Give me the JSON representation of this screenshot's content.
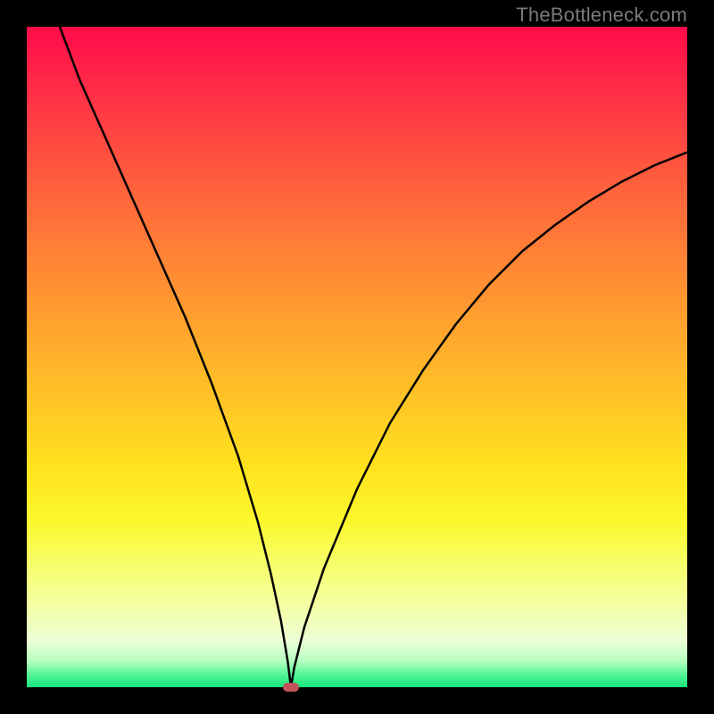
{
  "watermark": "TheBottleneck.com",
  "colors": {
    "frame": "#000000",
    "curve": "#000000",
    "marker": "#c25358"
  },
  "chart_data": {
    "type": "line",
    "title": "",
    "xlabel": "",
    "ylabel": "",
    "xlim": [
      0,
      100
    ],
    "ylim": [
      0,
      100
    ],
    "grid": false,
    "legend": false,
    "series": [
      {
        "name": "curve",
        "x": [
          5,
          8,
          12,
          16,
          20,
          24,
          28,
          32,
          35,
          37,
          38.5,
          39.5,
          40,
          40.5,
          42,
          45,
          50,
          55,
          60,
          65,
          70,
          75,
          80,
          85,
          90,
          95,
          100
        ],
        "y": [
          100,
          92,
          83,
          74,
          65,
          56,
          46,
          35,
          25,
          17,
          10,
          4,
          0,
          3,
          9,
          18,
          30,
          40,
          48,
          55,
          61,
          66,
          70,
          73.5,
          76.5,
          79,
          81
        ]
      }
    ],
    "marker": {
      "x": 40,
      "y": 0
    },
    "background_gradient": [
      {
        "stop": 0,
        "color": "#ff0b4a"
      },
      {
        "stop": 50,
        "color": "#ffb62a"
      },
      {
        "stop": 75,
        "color": "#fbf82e"
      },
      {
        "stop": 100,
        "color": "#18e47e"
      }
    ]
  }
}
